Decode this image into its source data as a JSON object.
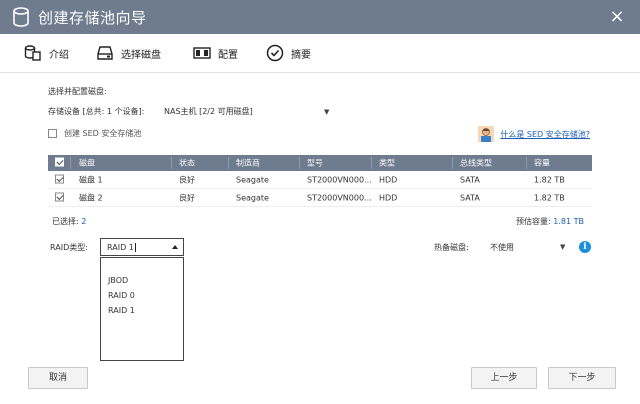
{
  "window": {
    "title": "创建存储池向导",
    "close_glyph": "×"
  },
  "steps": [
    {
      "label": "介绍",
      "icon": "intro-icon"
    },
    {
      "label": "选择磁盘",
      "icon": "disk-icon"
    },
    {
      "label": "配置",
      "icon": "config-icon"
    },
    {
      "label": "摘要",
      "icon": "summary-check-icon"
    }
  ],
  "form": {
    "section_title": "选择并配置磁盘:",
    "device_label": "存储设备 [总共: 1 个设备]:",
    "device_value": "NAS主机 [2/2 可用磁盘]",
    "sed_label": "创建 SED 安全存储池",
    "sed_help_link": "什么是 SED 安全存储池?"
  },
  "table": {
    "headers": [
      "磁盘",
      "状态",
      "制造商",
      "型号",
      "类型",
      "总线类型",
      "容量"
    ],
    "rows": [
      {
        "disk": "磁盘 1",
        "status": "良好",
        "maker": "Seagate",
        "model": "ST2000VN000...",
        "type": "HDD",
        "bus": "SATA",
        "capacity": "1.82 TB"
      },
      {
        "disk": "磁盘 2",
        "status": "良好",
        "maker": "Seagate",
        "model": "ST2000VN000...",
        "type": "HDD",
        "bus": "SATA",
        "capacity": "1.82 TB"
      }
    ]
  },
  "summary": {
    "selected_label": "已选择:",
    "selected_count": "2",
    "capacity_label": "预估容量:",
    "capacity_value": "1.81 TB"
  },
  "raid": {
    "label": "RAID类型:",
    "selected": "RAID 1",
    "options": [
      "JBOD",
      "RAID 0",
      "RAID 1"
    ]
  },
  "hot_spare": {
    "label": "热备磁盘:",
    "value": "不使用"
  },
  "buttons": {
    "cancel": "取消",
    "prev": "上一步",
    "next": "下一步"
  },
  "colors": {
    "titlebar": "#6f7b8e",
    "link": "#1a5fb4",
    "info": "#1a8fdd"
  }
}
